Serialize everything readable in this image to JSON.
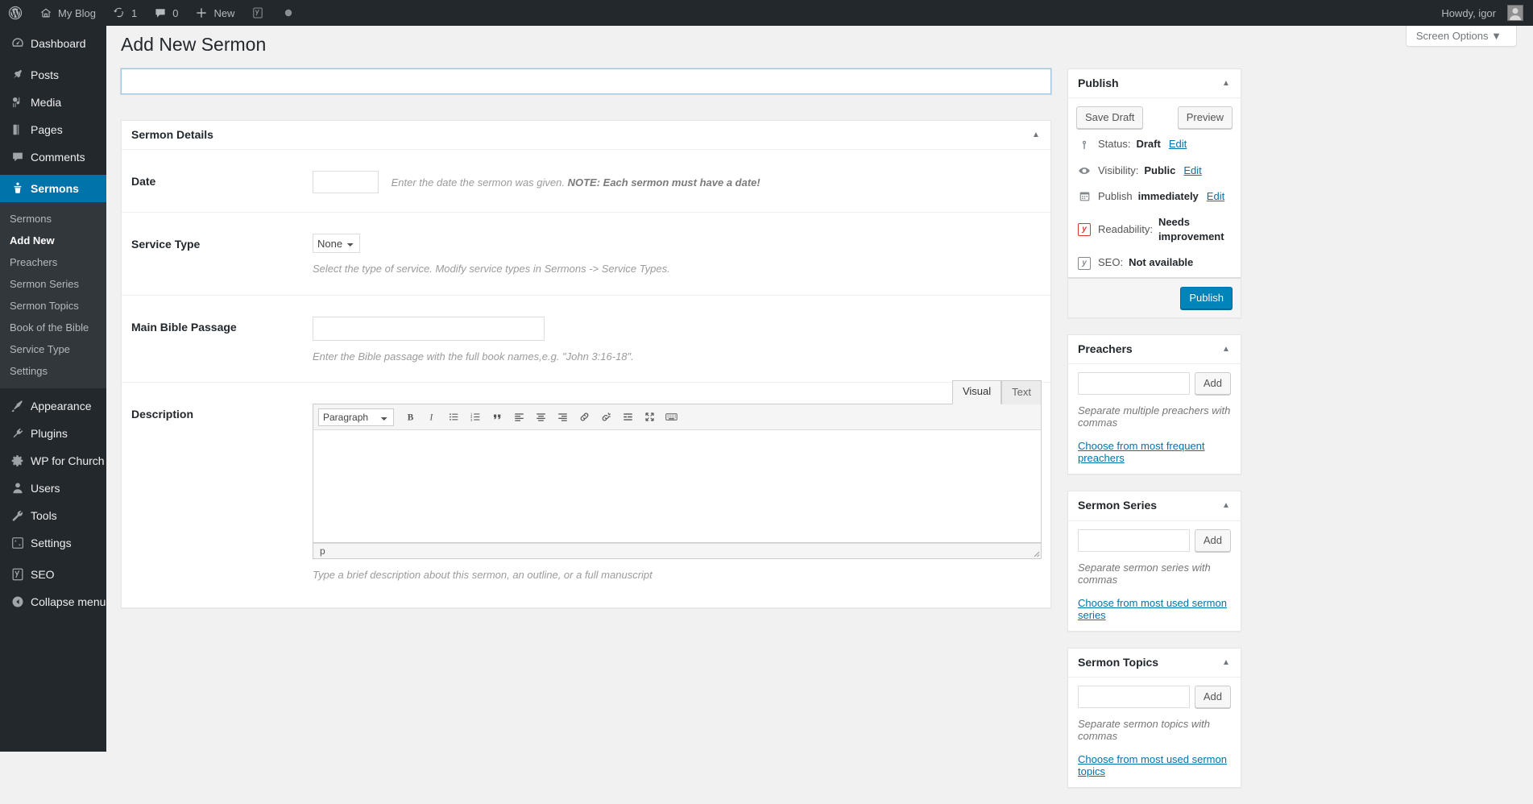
{
  "adminbar": {
    "wp_logo": "wordpress-logo",
    "site_name": "My Blog",
    "updates_count": "1",
    "comments_count": "0",
    "new_label": "New",
    "seo_label": "yoast-seo-icon",
    "howdy": "Howdy, igor"
  },
  "screen_meta": {
    "screen_options": "Screen Options"
  },
  "sidebar": {
    "items": [
      {
        "label": "Dashboard",
        "icon": "dashboard-icon",
        "current": false
      },
      {
        "label": "Posts",
        "icon": "pin-icon",
        "current": false
      },
      {
        "label": "Media",
        "icon": "media-icon",
        "current": false
      },
      {
        "label": "Pages",
        "icon": "pages-icon",
        "current": false
      },
      {
        "label": "Comments",
        "icon": "comments-icon",
        "current": false
      },
      {
        "label": "Sermons",
        "icon": "pulpit-icon",
        "current": true
      },
      {
        "label": "Appearance",
        "icon": "brush-icon",
        "current": false
      },
      {
        "label": "Plugins",
        "icon": "plug-icon",
        "current": false
      },
      {
        "label": "WP for Church",
        "icon": "gear-icon",
        "current": false
      },
      {
        "label": "Users",
        "icon": "user-icon",
        "current": false
      },
      {
        "label": "Tools",
        "icon": "wrench-icon",
        "current": false
      },
      {
        "label": "Settings",
        "icon": "sliders-icon",
        "current": false
      },
      {
        "label": "SEO",
        "icon": "yoast-seo-icon",
        "current": false
      },
      {
        "label": "Collapse menu",
        "icon": "collapse-icon",
        "current": false
      }
    ],
    "submenu": [
      {
        "label": "Sermons",
        "current": false
      },
      {
        "label": "Add New",
        "current": true
      },
      {
        "label": "Preachers",
        "current": false
      },
      {
        "label": "Sermon Series",
        "current": false
      },
      {
        "label": "Sermon Topics",
        "current": false
      },
      {
        "label": "Book of the Bible",
        "current": false
      },
      {
        "label": "Service Type",
        "current": false
      },
      {
        "label": "Settings",
        "current": false
      }
    ]
  },
  "page": {
    "title": "Add New Sermon",
    "post_title_value": "",
    "post_title_placeholder": ""
  },
  "sermon_details": {
    "box_title": "Sermon Details",
    "rows": {
      "date": {
        "label": "Date",
        "value": "",
        "desc_normal": "Enter the date the sermon was given. ",
        "desc_bold": "NOTE: Each sermon must have a date!"
      },
      "service_type": {
        "label": "Service Type",
        "selected": "None",
        "options": [
          "None"
        ],
        "desc": "Select the type of service. Modify service types in Sermons -> Service Types."
      },
      "bible_passage": {
        "label": "Main Bible Passage",
        "value": "",
        "desc": "Enter the Bible passage with the full book names,e.g. \"John 3:16-18\"."
      },
      "description": {
        "label": "Description",
        "desc": "Type a brief description about this sermon, an outline, or a full manuscript",
        "tabs": [
          {
            "label": "Visual",
            "active": true
          },
          {
            "label": "Text",
            "active": false
          }
        ],
        "format_selected": "Paragraph",
        "format_options": [
          "Paragraph"
        ],
        "toolbar": [
          "bold-icon",
          "italic-icon",
          "bulleted-list-icon",
          "numbered-list-icon",
          "blockquote-icon",
          "align-left-icon",
          "align-center-icon",
          "align-right-icon",
          "link-icon",
          "unlink-icon",
          "read-more-icon",
          "fullscreen-icon",
          "keyboard-shortcuts-icon"
        ],
        "content": "",
        "statusbar_path": "p"
      }
    }
  },
  "publish_box": {
    "title": "Publish",
    "save_draft": "Save Draft",
    "preview": "Preview",
    "status_label": "Status:",
    "status_value": "Draft",
    "status_edit": "Edit",
    "visibility_label": "Visibility:",
    "visibility_value": "Public",
    "visibility_edit": "Edit",
    "publish_label": "Publish",
    "publish_value": "immediately",
    "publish_edit": "Edit",
    "readability_label": "Readability:",
    "readability_value": "Needs improvement",
    "seo_label": "SEO:",
    "seo_value": "Not available",
    "publish_button": "Publish",
    "readability_color": "#dc3232",
    "seo_color": "#82878c",
    "primary_color": "#0085ba"
  },
  "preachers_box": {
    "title": "Preachers",
    "input_value": "",
    "add_label": "Add",
    "hint": "Separate multiple preachers with commas",
    "cloud_link": "Choose from most frequent preachers"
  },
  "series_box": {
    "title": "Sermon Series",
    "input_value": "",
    "add_label": "Add",
    "hint": "Separate sermon series with commas",
    "cloud_link": "Choose from most used sermon series"
  },
  "topics_box": {
    "title": "Sermon Topics",
    "input_value": "",
    "add_label": "Add",
    "hint": "Separate sermon topics with commas",
    "cloud_link": "Choose from most used sermon topics"
  }
}
